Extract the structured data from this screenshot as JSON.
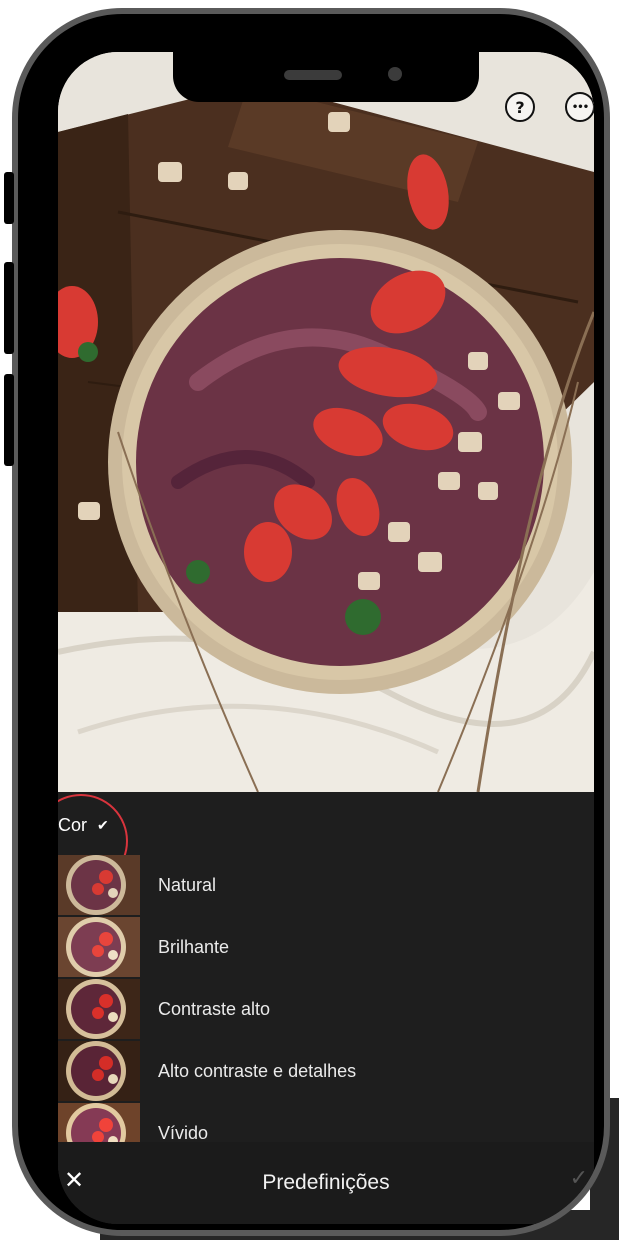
{
  "toolbar": {
    "help_icon": "help-icon",
    "more_icon": "more-icon",
    "help_glyph": "?",
    "more_glyph": "•••"
  },
  "panel": {
    "category": "Cor",
    "presets": [
      {
        "label": "Natural"
      },
      {
        "label": "Brilhante"
      },
      {
        "label": "Contraste alto"
      },
      {
        "label": "Alto contraste e detalhes"
      },
      {
        "label": "Vívido"
      }
    ]
  },
  "footer": {
    "title": "Predefinições",
    "close_glyph": "✕",
    "confirm_glyph": "✓"
  },
  "colors": {
    "panel_bg": "#1e1e1e",
    "highlight": "#d9343d"
  }
}
